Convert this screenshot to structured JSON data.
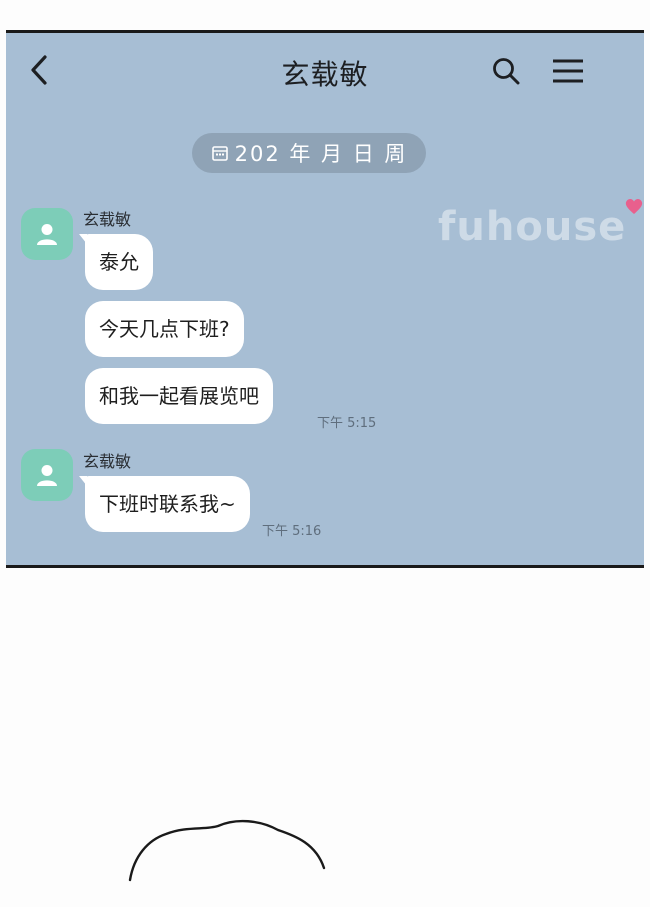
{
  "header": {
    "title": "玄载敏",
    "back_icon": "chevron-left-icon",
    "search_icon": "search-icon",
    "menu_icon": "hamburger-menu-icon"
  },
  "date_divider": {
    "icon": "calendar-icon",
    "text": "202 年 月 日 周"
  },
  "messages": [
    {
      "sender": "玄载敏",
      "avatar_icon": "person-icon",
      "bubbles": [
        "泰允",
        "今天几点下班?",
        "和我一起看展览吧"
      ],
      "time": "下午 5:15"
    },
    {
      "sender": "玄载敏",
      "avatar_icon": "person-icon",
      "bubbles": [
        "下班时联系我~"
      ],
      "time": "下午 5:16"
    }
  ],
  "watermark": "fuhouse",
  "colors": {
    "chat_background": "#a7bed4",
    "bubble": "#ffffff",
    "avatar": "#7dcdb8",
    "date_pill": "#8fa3b6",
    "heart": "#e8608d"
  }
}
